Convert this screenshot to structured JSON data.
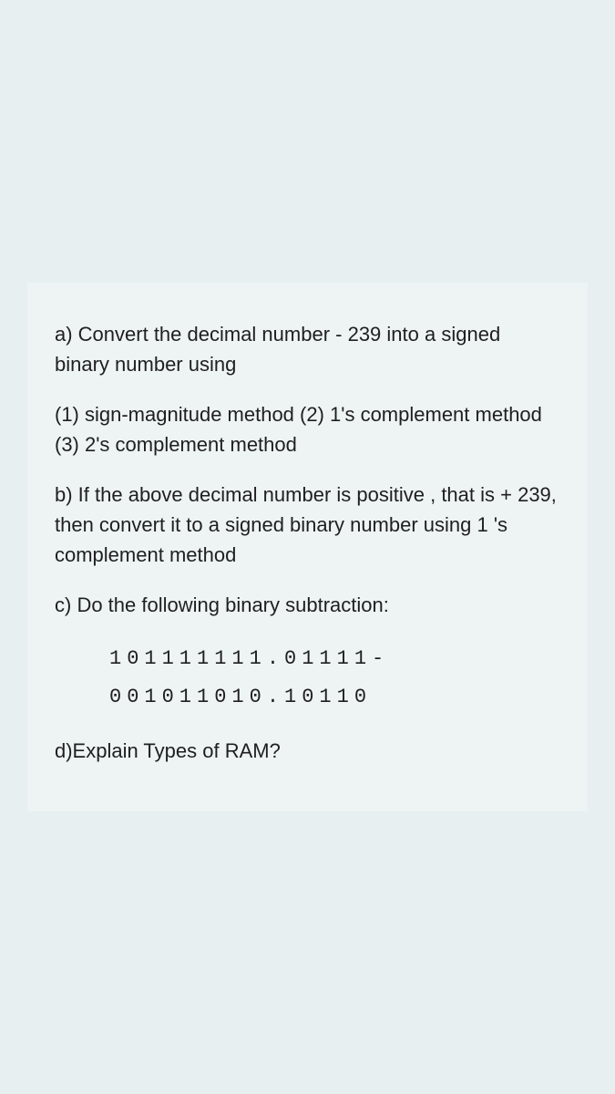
{
  "question": {
    "a": {
      "text_line1": "a) Convert the decimal number - 239  into a",
      "text_line2": "signed binary number using",
      "sub": "(1) sign-magnitude method   (2) 1's complement method   (3) 2's complement method"
    },
    "b": {
      "text": "b) If the above decimal number is positive , that is  + 239,  then convert it to a signed binary number using 1 's complement method"
    },
    "c": {
      "intro": "c)  Do the following binary subtraction:",
      "line1": "101111111.01111-",
      "line2": "001011010.10110"
    },
    "d": {
      "text": "d)Explain Types of RAM?"
    }
  }
}
